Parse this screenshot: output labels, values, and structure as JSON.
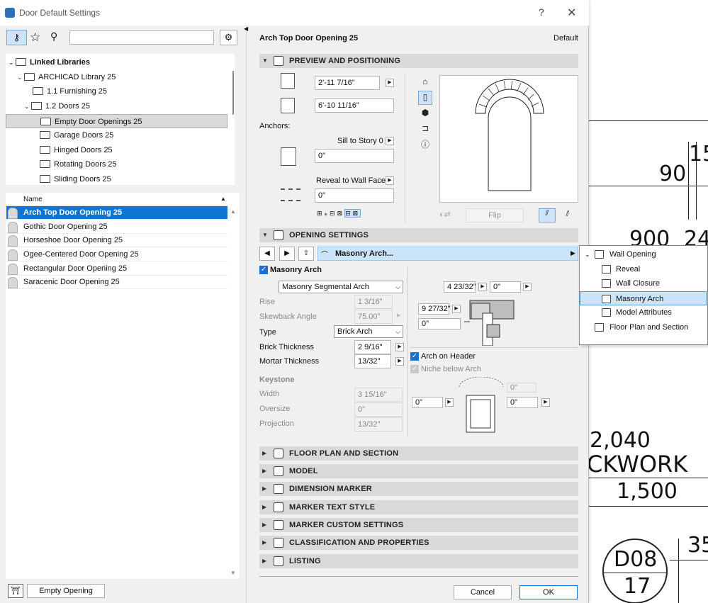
{
  "window": {
    "title": "Door Default Settings",
    "help": "?",
    "close": "✕"
  },
  "background_drawing": {
    "dims": [
      "90",
      "15",
      "900",
      "24",
      "2,040",
      "CKWORK",
      "1,500",
      "D08",
      "17",
      "35"
    ]
  },
  "library": {
    "search_placeholder": "",
    "tree": [
      {
        "label": "Linked Libraries",
        "level": 0,
        "bold": true
      },
      {
        "label": "ARCHICAD Library 25",
        "level": 1
      },
      {
        "label": "1.1 Furnishing 25",
        "level": 2
      },
      {
        "label": "1.2 Doors 25",
        "level": 2
      },
      {
        "label": "Empty Door Openings 25",
        "level": 3,
        "selected": true
      },
      {
        "label": "Garage Doors 25",
        "level": 3
      },
      {
        "label": "Hinged Doors 25",
        "level": 3
      },
      {
        "label": "Rotating Doors 25",
        "level": 3
      },
      {
        "label": "Sliding Doors 25",
        "level": 3
      }
    ],
    "list_header": "Name",
    "items": [
      {
        "label": "Arch Top Door Opening 25",
        "selected": true
      },
      {
        "label": "Gothic Door Opening 25"
      },
      {
        "label": "Horseshoe Door Opening 25"
      },
      {
        "label": "Ogee-Centered Door Opening 25"
      },
      {
        "label": "Rectangular Door Opening 25"
      },
      {
        "label": "Saracenic Door Opening 25"
      }
    ],
    "footer_button": "Empty Opening"
  },
  "settings": {
    "object_name": "Arch Top Door Opening 25",
    "default_label": "Default",
    "preview": {
      "header": "PREVIEW AND POSITIONING",
      "width": "2'-11 7/16\"",
      "height": "6'-10 11/16\"",
      "anchors_label": "Anchors:",
      "sill_label": "Sill to Story 0",
      "sill_value": "0\"",
      "reveal_label": "Reveal to Wall Face",
      "reveal_value": "0\"",
      "flip_label": "Flip"
    },
    "opening": {
      "header": "OPENING SETTINGS",
      "nav_current": "Masonry Arch...",
      "masonry_arch_label": "Masonry Arch",
      "arch_type": "Masonry Segmental Arch",
      "rise_label": "Rise",
      "rise_value": "1 3/16\"",
      "skewback_label": "Skewback Angle",
      "skewback_value": "75.00°",
      "type_label": "Type",
      "type_value": "Brick Arch",
      "brick_label": "Brick Thickness",
      "brick_value": "2 9/16\"",
      "mortar_label": "Mortar Thickness",
      "mortar_value": "13/32\"",
      "keystone_label": "Keystone",
      "kwidth_label": "Width",
      "kwidth_value": "3 15/16\"",
      "oversize_label": "Oversize",
      "oversize_value": "0\"",
      "projection_label": "Projection",
      "projection_value": "13/32\"",
      "diagram_a": "4 23/32\"",
      "diagram_b": "0\"",
      "diagram_c": "9 27/32\"",
      "diagram_d": "0\"",
      "arch_on_header_label": "Arch on Header",
      "niche_label": "Niche below Arch",
      "niche_a": "0\"",
      "niche_b": "0\"",
      "niche_c": "0\"",
      "niche_d": "0\""
    },
    "collapsed_sections": [
      "FLOOR PLAN AND SECTION",
      "MODEL",
      "DIMENSION MARKER",
      "MARKER TEXT STYLE",
      "MARKER CUSTOM SETTINGS",
      "CLASSIFICATION AND PROPERTIES",
      "LISTING"
    ],
    "cancel_label": "Cancel",
    "ok_label": "OK"
  },
  "popup": {
    "parent": "Wall Opening",
    "items": [
      {
        "label": "Reveal"
      },
      {
        "label": "Wall Closure"
      },
      {
        "label": "Masonry Arch",
        "selected": true
      },
      {
        "label": "Model Attributes"
      },
      {
        "label": "Floor Plan and Section"
      }
    ]
  },
  "colors": {
    "accent": "#0f75d5",
    "selection_light": "#cce4f7",
    "section_bg": "#d9d9d9"
  }
}
